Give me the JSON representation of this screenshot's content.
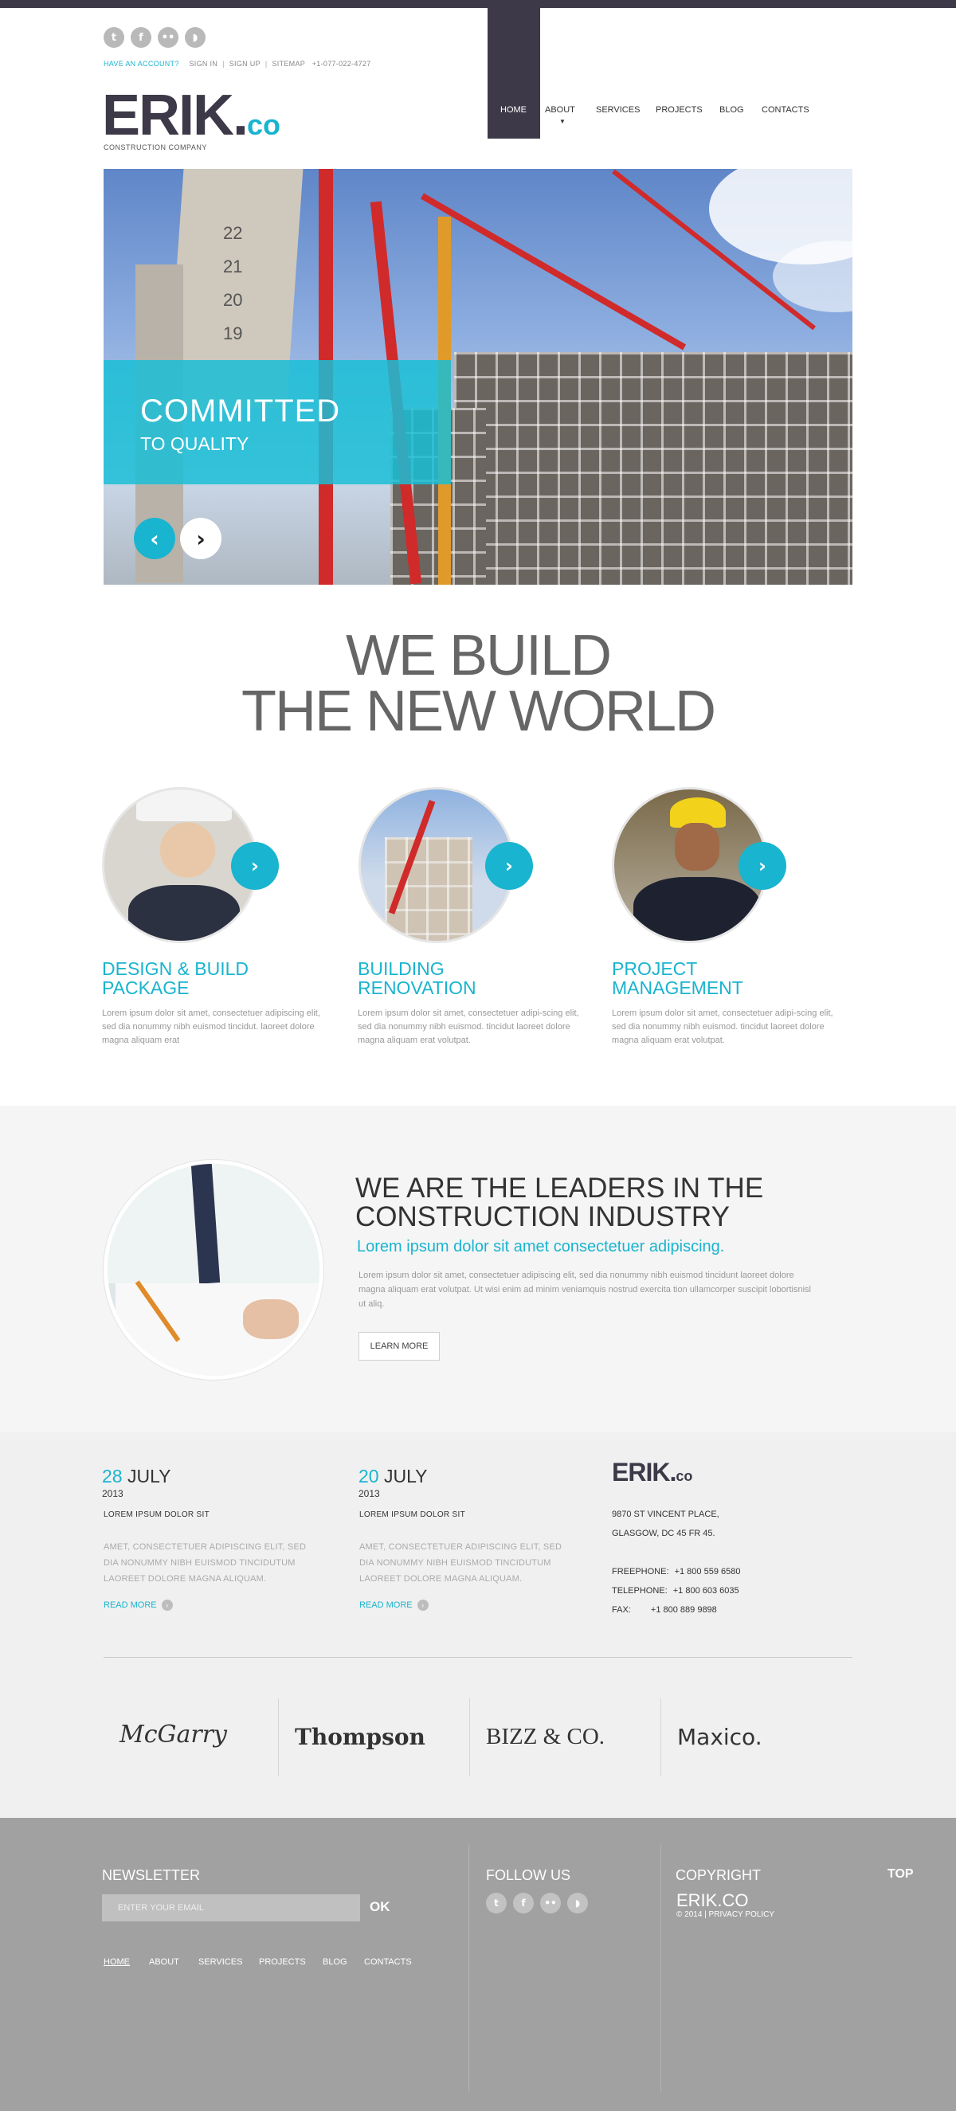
{
  "header": {
    "social": [
      "twitter-icon",
      "facebook-icon",
      "flickr-icon",
      "rss-icon"
    ],
    "have_account": "HAVE AN ACCOUNT?",
    "sign_in": "SIGN IN",
    "sign_up": "SIGN UP",
    "sitemap": "SITEMAP",
    "phone": "+1-077-022-4727",
    "logo_main": "ERIK.",
    "logo_co": "co",
    "logo_sub": "CONSTRUCTION COMPANY",
    "nav": [
      "HOME",
      "ABOUT",
      "SERVICES",
      "PROJECTS",
      "BLOG",
      "CONTACTS"
    ],
    "nav_active": "HOME"
  },
  "slider": {
    "caption_line1": "COMMITTED",
    "caption_line2": "TO QUALITY",
    "prev_icon": "‹",
    "next_icon": "›",
    "floor_numbers": [
      "22",
      "21",
      "20",
      "19"
    ]
  },
  "headline": {
    "line1": "WE BUILD",
    "line2": "THE NEW WORLD"
  },
  "services": [
    {
      "title": "DESIGN & BUILD PACKAGE",
      "text": "Lorem ipsum dolor sit amet, consectetuer adipiscing elit, sed dia nonummy nibh euismod tincidut. laoreet dolore magna aliquam erat"
    },
    {
      "title": "BUILDING RENOVATION",
      "text": "Lorem ipsum dolor sit amet, consectetuer adipi-scing elit, sed dia nonummy nibh euismod. tincidut laoreet dolore magna aliquam erat volutpat."
    },
    {
      "title": "PROJECT MANAGEMENT",
      "text": "Lorem ipsum dolor sit amet, consectetuer adipi-scing elit, sed dia nonummy nibh euismod. tincidut laoreet dolore magna aliquam erat volutpat."
    }
  ],
  "leaders": {
    "title": "WE ARE THE LEADERS IN THE CONSTRUCTION INDUSTRY",
    "subtitle": "Lorem ipsum dolor sit amet consectetuer adipiscing.",
    "text": "Lorem ipsum dolor sit amet, consectetuer adipiscing elit, sed dia nonummy nibh euismod tincidunt laoreet dolore magna aliquam erat volutpat. Ut wisi enim ad minim veniamquis nostrud exercita tion ullamcorper suscipit lobortisnisl ut aliq.",
    "button": "LEARN MORE"
  },
  "news": [
    {
      "day": "28",
      "month": "JULY",
      "year": "2013",
      "title": "LOREM IPSUM DOLOR SIT",
      "text": "AMET, CONSECTETUER ADIPISCING ELIT, SED DIA NONUMMY NIBH EUISMOD TINCIDUTUM LAOREET DOLORE MAGNA ALIQUAM.",
      "read_more": "READ MORE"
    },
    {
      "day": "20",
      "month": "JULY",
      "year": "2013",
      "title": "LOREM IPSUM DOLOR SIT",
      "text": "AMET, CONSECTETUER ADIPISCING ELIT, SED DIA NONUMMY NIBH EUISMOD TINCIDUTUM LAOREET DOLORE MAGNA ALIQUAM.",
      "read_more": "READ MORE"
    }
  ],
  "contact": {
    "logo_main": "ERIK.",
    "logo_co": "co",
    "address1": "9870 ST VINCENT PLACE,",
    "address2": "GLASGOW, DC 45 FR 45.",
    "freephone_label": "FREEPHONE:",
    "freephone": "+1 800 559 6580",
    "telephone_label": "TELEPHONE:",
    "telephone": "+1 800 603 6035",
    "fax_label": "FAX:",
    "fax": "+1 800 889 9898"
  },
  "brands": [
    "McGarry",
    "Thompson",
    "BIZZ & CO.",
    "Maxico."
  ],
  "footer": {
    "newsletter_title": "NEWSLETTER",
    "email_placeholder": "ENTER YOUR EMAIL",
    "ok": "OK",
    "follow_title": "FOLLOW US",
    "copyright_title": "COPYRIGHT",
    "copyright_brand": "ERIK.CO",
    "copyright_line": "© 2014 | PRIVACY POLICY",
    "top": "TOP",
    "nav": [
      "HOME",
      "ABOUT",
      "SERVICES",
      "PROJECTS",
      "BLOG",
      "CONTACTS"
    ]
  },
  "colors": {
    "accent": "#19b4cf",
    "dark": "#3d3948",
    "footer": "#a1a1a1"
  }
}
